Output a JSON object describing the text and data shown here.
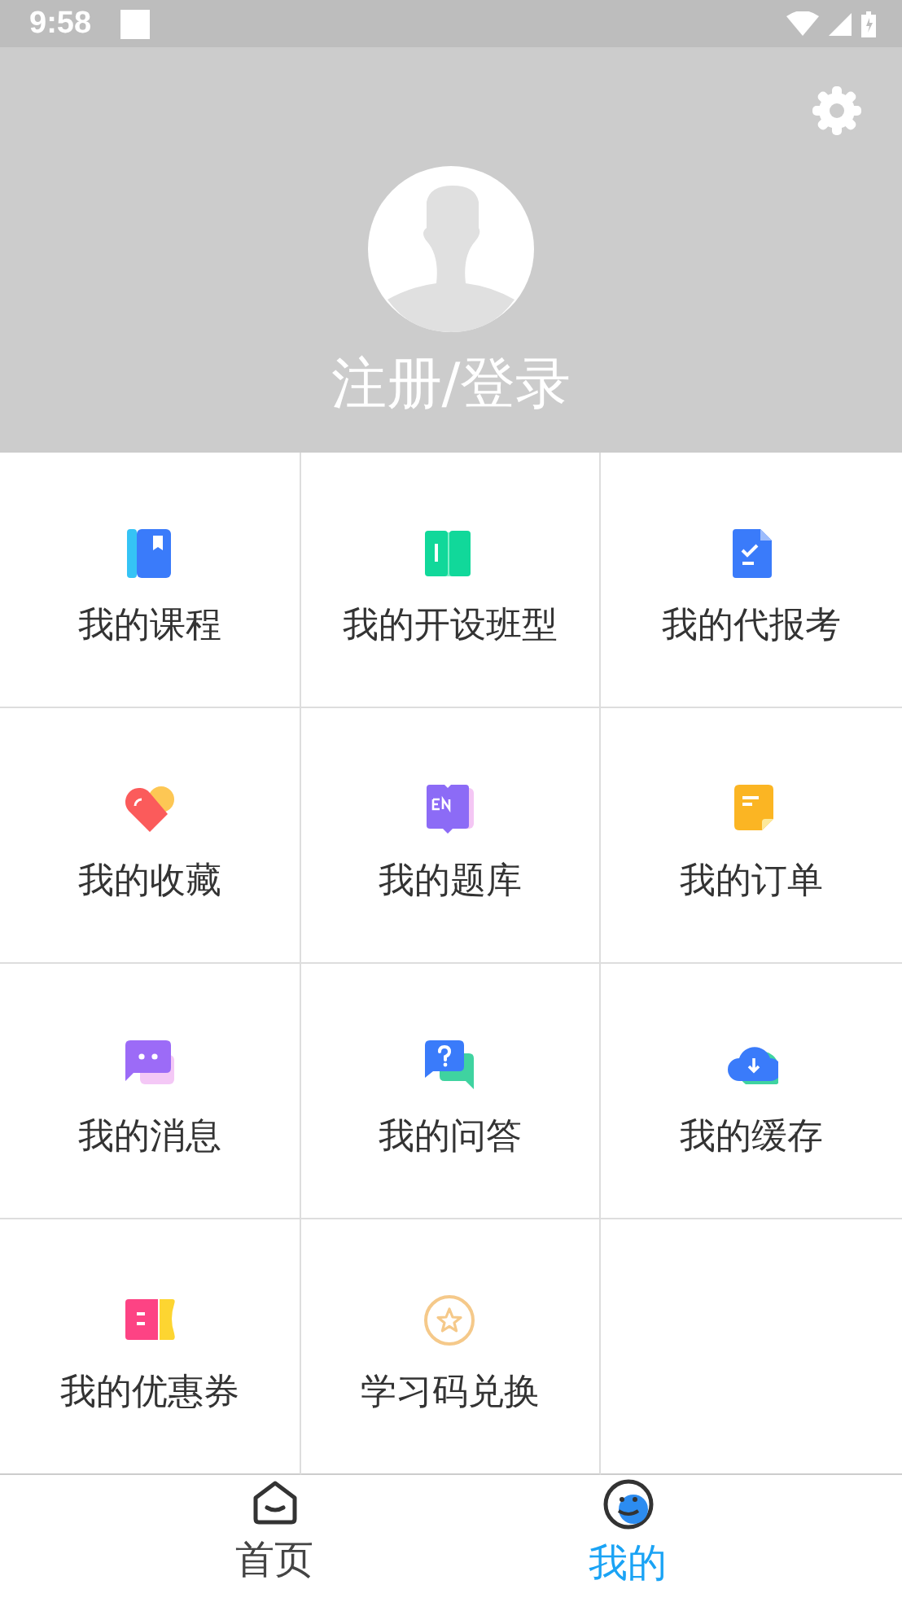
{
  "status_bar": {
    "time": "9:58"
  },
  "profile": {
    "login_label": "注册/登录"
  },
  "menu": [
    {
      "kind": "course",
      "label": "我的课程"
    },
    {
      "kind": "class",
      "label": "我的开设班型"
    },
    {
      "kind": "exam",
      "label": "我的代报考"
    },
    {
      "kind": "favorite",
      "label": "我的收藏"
    },
    {
      "kind": "bank",
      "label": "我的题库"
    },
    {
      "kind": "order",
      "label": "我的订单"
    },
    {
      "kind": "message",
      "label": "我的消息"
    },
    {
      "kind": "qa",
      "label": "我的问答"
    },
    {
      "kind": "cache",
      "label": "我的缓存"
    },
    {
      "kind": "coupon",
      "label": "我的优惠券"
    },
    {
      "kind": "code",
      "label": "学习码兑换"
    }
  ],
  "bottom_nav": [
    {
      "kind": "home",
      "label": "首页",
      "selected": false
    },
    {
      "kind": "me",
      "label": "我的",
      "selected": true
    }
  ]
}
